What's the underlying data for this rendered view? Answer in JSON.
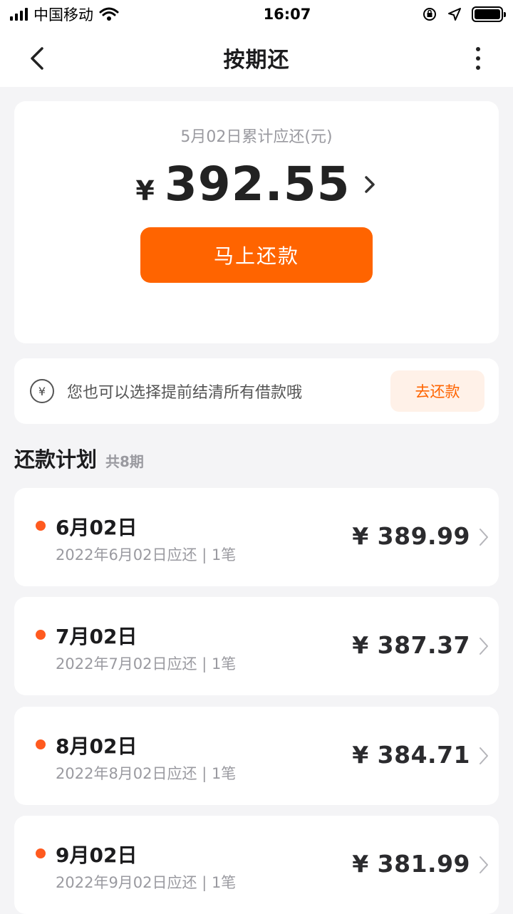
{
  "status_bar": {
    "carrier": "中国移动",
    "time": "16:07"
  },
  "nav": {
    "title": "按期还"
  },
  "summary": {
    "label": "5月02日累计应还(元)",
    "currency": "¥",
    "amount": "392.55",
    "pay_button": "马上还款"
  },
  "prepay": {
    "icon_glyph": "¥",
    "text": "您也可以选择提前结清所有借款哦",
    "button": "去还款"
  },
  "plan": {
    "title": "还款计划",
    "count": "共8期",
    "items": [
      {
        "date": "6月02日",
        "sub": "2022年6月02日应还 | 1笔",
        "amount": "¥ 389.99"
      },
      {
        "date": "7月02日",
        "sub": "2022年7月02日应还 | 1笔",
        "amount": "¥ 387.37"
      },
      {
        "date": "8月02日",
        "sub": "2022年8月02日应还 | 1笔",
        "amount": "¥ 384.71"
      },
      {
        "date": "9月02日",
        "sub": "2022年9月02日应还 | 1笔",
        "amount": "¥ 381.99"
      }
    ]
  },
  "colors": {
    "accent": "#ff6400",
    "dot": "#ff5a1f",
    "background": "#f4f4f6"
  }
}
